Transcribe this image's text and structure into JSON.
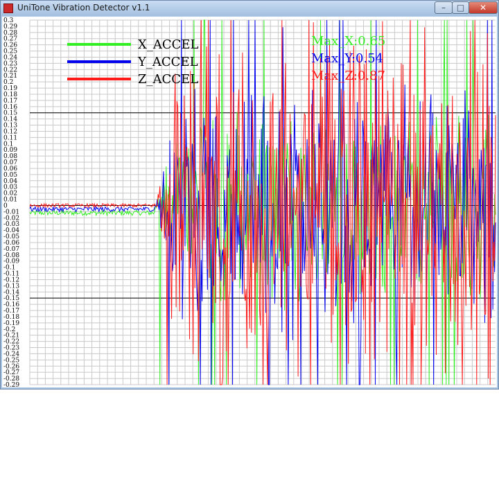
{
  "window": {
    "title": "UniTone Vibration Detector v1.1"
  },
  "controls": {
    "minimize": "–",
    "maximize": "□",
    "close": "✕"
  },
  "colors": {
    "x": "#33ee22",
    "y": "#0000ee",
    "z": "#ff1a1a",
    "grid": "#c8c8c8",
    "refline": "#000000"
  },
  "legend": [
    {
      "label": "X_ACCEL",
      "color": "#33ee22"
    },
    {
      "label": "Y_ACCEL",
      "color": "#0000ee"
    },
    {
      "label": "Z_ACCEL",
      "color": "#ff1a1a"
    }
  ],
  "max_readouts": [
    {
      "label": "Max_X:0.65",
      "color": "#33ee22"
    },
    {
      "label": "Max_Y:0.54",
      "color": "#0000ee"
    },
    {
      "label": "Max_Z:0.87",
      "color": "#ff1a1a"
    }
  ],
  "chart_data": {
    "type": "line",
    "ylim": [
      -0.29,
      0.3
    ],
    "y_tick_step": 0.01,
    "reference_lines": [
      0.15,
      0.0,
      -0.15
    ],
    "series": [
      {
        "name": "X_ACCEL",
        "color": "#33ee22",
        "baseline": -0.012,
        "quiet_noise": 0.004,
        "active_amplitude": 0.13,
        "max": 0.65
      },
      {
        "name": "Y_ACCEL",
        "color": "#0000ee",
        "baseline": -0.006,
        "quiet_noise": 0.004,
        "active_amplitude": 0.16,
        "max": 0.54
      },
      {
        "name": "Z_ACCEL",
        "color": "#ff1a1a",
        "baseline": 0.0,
        "quiet_noise": 0.003,
        "active_amplitude": 0.24,
        "max": 0.87
      }
    ],
    "quiet_fraction": 0.27
  }
}
